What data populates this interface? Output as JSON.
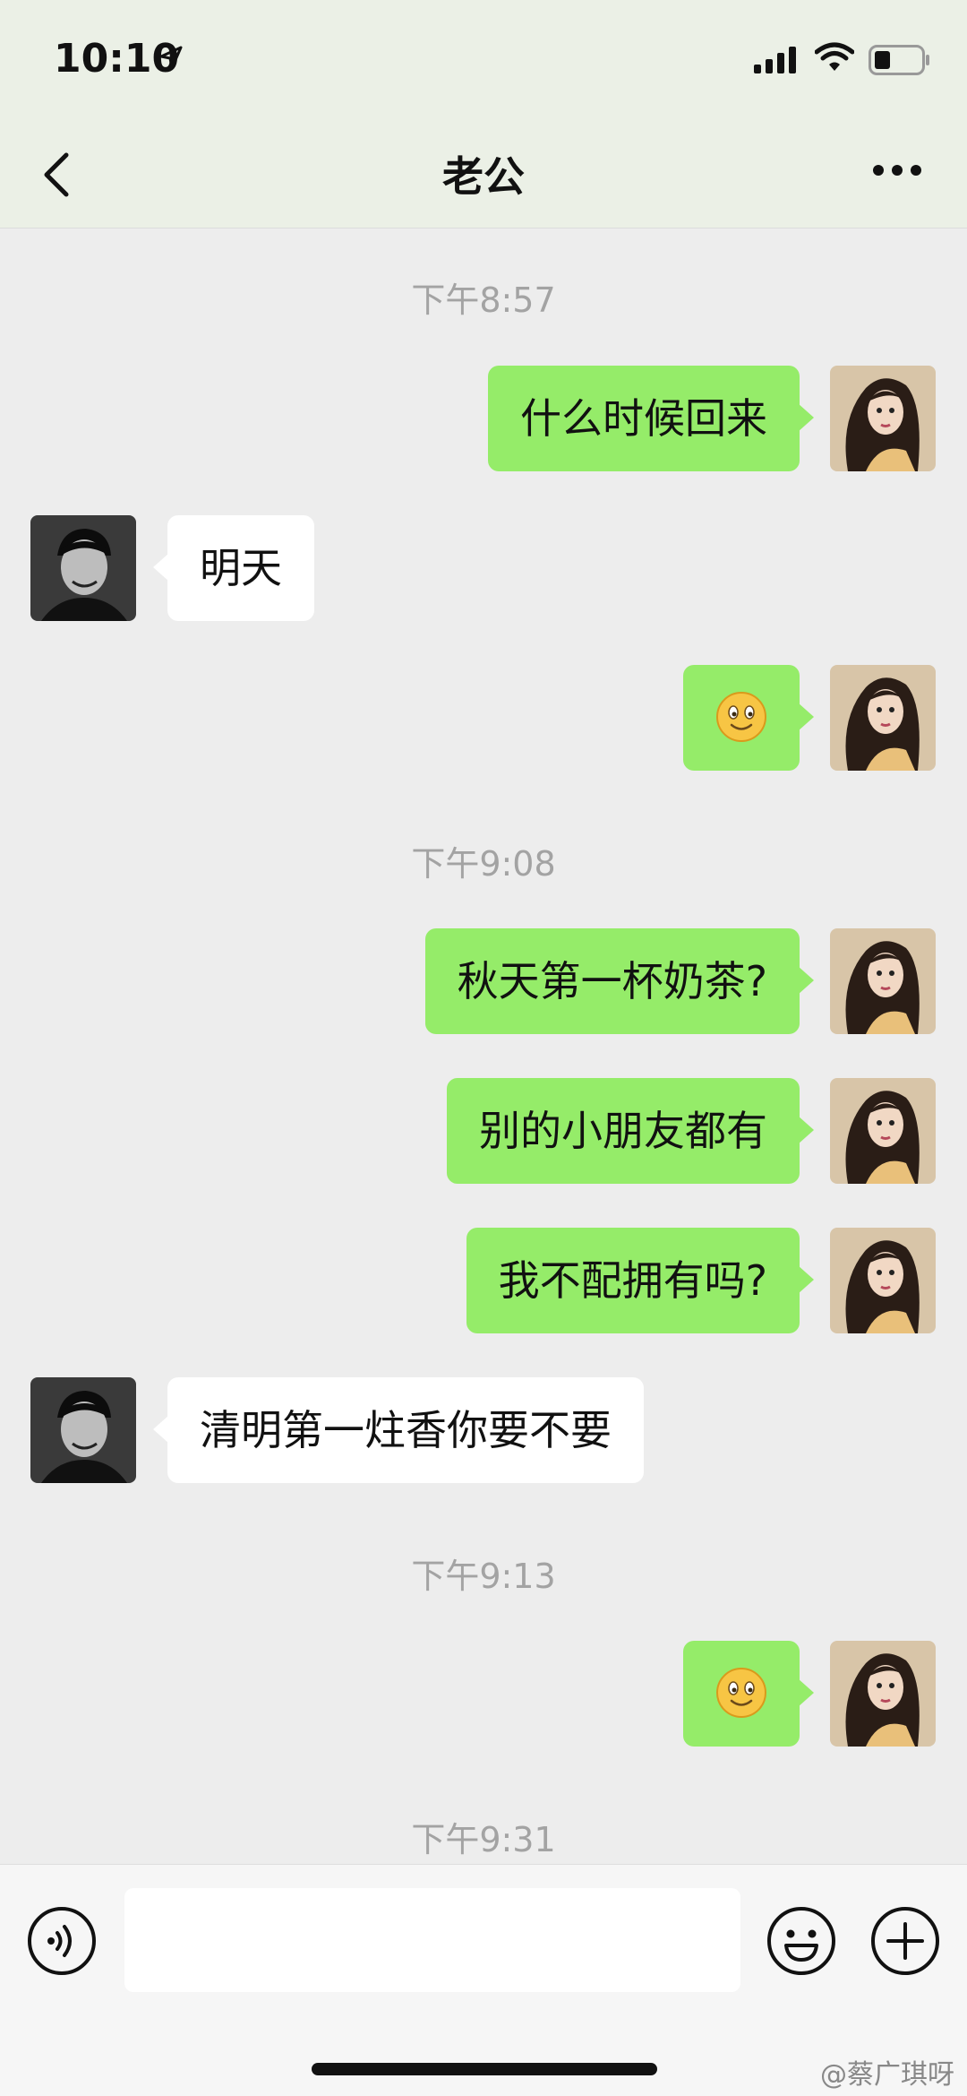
{
  "status_bar": {
    "time": "10:10",
    "icons": [
      "location-arrow-icon",
      "signal-icon",
      "wifi-icon",
      "battery-icon"
    ]
  },
  "nav": {
    "back_icon": "chevron-left-icon",
    "title": "老公",
    "more_icon": "more-dots-icon"
  },
  "timestamps": [
    "下午8:57",
    "下午9:08",
    "下午9:13",
    "下午9:31"
  ],
  "messages": [
    {
      "sender": "me",
      "type": "text",
      "text": "什么时候回来"
    },
    {
      "sender": "him",
      "type": "text",
      "text": "明天"
    },
    {
      "sender": "me",
      "type": "emoji",
      "icon": "smile-emoji-icon"
    },
    {
      "sender": "me",
      "type": "text",
      "text": "秋天第一杯奶茶?"
    },
    {
      "sender": "me",
      "type": "text",
      "text": "别的小朋友都有"
    },
    {
      "sender": "me",
      "type": "text",
      "text": "我不配拥有吗?"
    },
    {
      "sender": "him",
      "type": "text",
      "text": "清明第一炷香你要不要"
    },
    {
      "sender": "me",
      "type": "emoji",
      "icon": "smile-emoji-icon"
    }
  ],
  "input_bar": {
    "voice_icon": "voice-icon",
    "text_value": "",
    "emoji_icon": "emoji-icon",
    "plus_icon": "plus-icon"
  },
  "watermark": "@蔡广琪呀",
  "colors": {
    "my_bubble": "#95ec69",
    "his_bubble": "#ffffff",
    "background": "#ededed",
    "header": "#ebf0e6",
    "timestamp": "#a3a3a3"
  }
}
